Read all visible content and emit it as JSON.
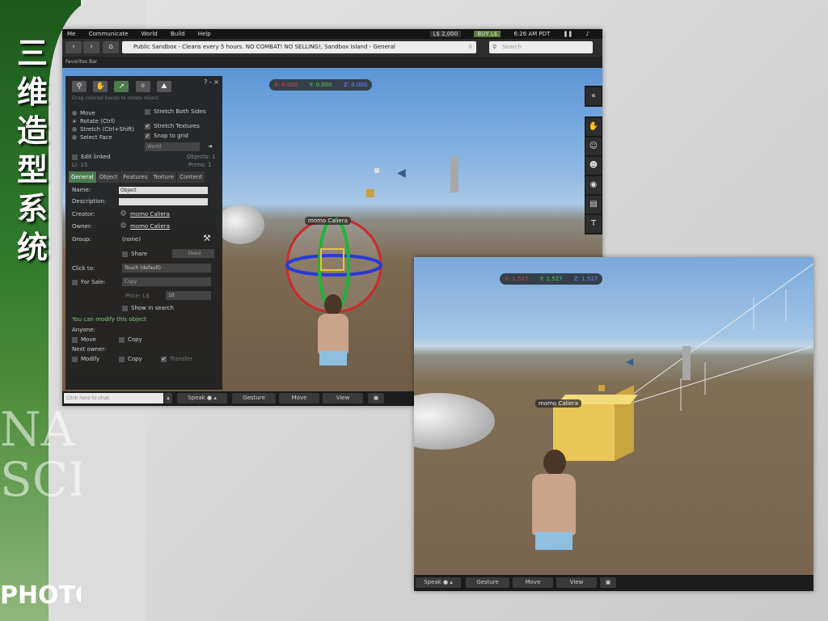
{
  "slide": {
    "vertical_title": [
      "三",
      "维",
      "造",
      "型",
      "系",
      "统"
    ],
    "watermark_lines": [
      "NA",
      "SCI"
    ],
    "watermark_bottom": "PHOTO"
  },
  "shot1": {
    "menu": [
      "Me",
      "Communicate",
      "World",
      "Build",
      "Help"
    ],
    "money": "L$ 2,000",
    "buy": "BUY L$",
    "time": "6:26 AM PDT",
    "url": "Public Sandbox - Cleans every 5 hours. NO COMBAT! NO SELLING!, Sandbox Island - General",
    "search_placeholder": "Search",
    "favorites": "Favorites Bar",
    "coords": {
      "x": "X: 0.000",
      "y": "Y: 0.000",
      "z": "Z: 0.000"
    },
    "avatar_name": "momo Caliera",
    "chat_placeholder": "Click here to chat.",
    "speak": "Speak",
    "gesture": "Gesture",
    "move": "Move",
    "view": "View",
    "build": {
      "title": "? -  ×",
      "hint": "Drag colored bands to rotate object",
      "modes": [
        "Move",
        "Rotate (Ctrl)",
        "Stretch (Ctrl+Shift)",
        "Select Face"
      ],
      "checks": [
        "Stretch Both Sides",
        "Stretch Textures",
        "Snap to grid"
      ],
      "ruler": "World",
      "edit_linked": "Edit linked",
      "objects": "Objects: 1",
      "prims": "Prims: 1",
      "li": "Li: 15",
      "tabs": [
        "General",
        "Object",
        "Features",
        "Texture",
        "Content"
      ],
      "name_label": "Name:",
      "name_value": "Object",
      "desc_label": "Description:",
      "creator_label": "Creator:",
      "creator_value": "momo Caliera",
      "owner_label": "Owner:",
      "owner_value": "momo Caliera",
      "group_label": "Group:",
      "group_value": "(none)",
      "share": "Share",
      "deed": "Deed",
      "click_label": "Click to:",
      "click_value": "Touch (default)",
      "for_sale": "For Sale:",
      "copy_opt": "Copy",
      "price_label": "Price: L$",
      "price_value": "10",
      "show_search": "Show in search",
      "modify_note": "You can modify this object",
      "anyone": "Anyone:",
      "anyone_move": "Move",
      "anyone_copy": "Copy",
      "next_owner": "Next owner:",
      "next_modify": "Modify",
      "next_copy": "Copy",
      "next_transfer": "Transfer"
    },
    "dock_icons": [
      "collapse-icon",
      "hand-icon",
      "person-icon",
      "people-icon",
      "camera-icon",
      "inventory-icon",
      "shirt-icon"
    ]
  },
  "shot2": {
    "coords": {
      "x": "X: 1.527",
      "y": "Y: 1.527",
      "z": "Z: 1.527"
    },
    "avatar_name": "momo Caliera",
    "speak": "Speak",
    "gesture": "Gesture",
    "move": "Move",
    "view": "View"
  }
}
